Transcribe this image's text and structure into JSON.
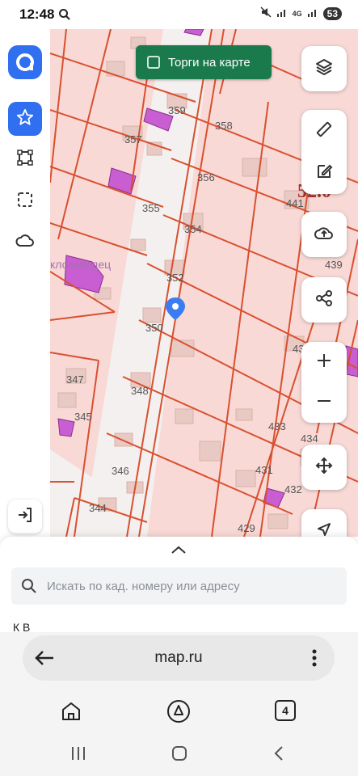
{
  "status": {
    "time": "12:48",
    "network": "4G",
    "battery": "53"
  },
  "sidebar": {
    "logo_icon": "app-logo-icon",
    "items": [
      {
        "icon": "star-icon",
        "active": true
      },
      {
        "icon": "polygon-icon"
      },
      {
        "icon": "dashed-square-icon"
      },
      {
        "icon": "cloud-icon"
      }
    ],
    "login_icon": "login-icon"
  },
  "torgi": {
    "label": "Торги на карте",
    "checked": false
  },
  "map": {
    "street_label": "...клозаводец",
    "parcels": [
      "359",
      "358",
      "357",
      "356",
      "355",
      "354",
      "352",
      "350",
      "348",
      "347",
      "345",
      "346",
      "344",
      "441",
      "439",
      "433",
      "434",
      "431",
      "432",
      "429",
      "43"
    ],
    "scale_label": "52.0"
  },
  "right_tools": [
    "layers-icon",
    "ruler-icon",
    "edit-icon",
    "cloud-upload-icon",
    "share-icon",
    "zoom-in-icon",
    "zoom-out-icon",
    "move-icon",
    "navigate-icon"
  ],
  "search": {
    "placeholder": "Искать по кад. номеру или адресу"
  },
  "sheet_peek": "К                             В",
  "browser": {
    "url": "map.ru",
    "tabs_count": "4"
  },
  "colors": {
    "brand": "#2f6ff0",
    "torgi_bg": "#1b7a4c",
    "parcel_line": "#d9502f",
    "parcel_fill": "#f8d9d6",
    "highlight": "#c85ed1"
  }
}
